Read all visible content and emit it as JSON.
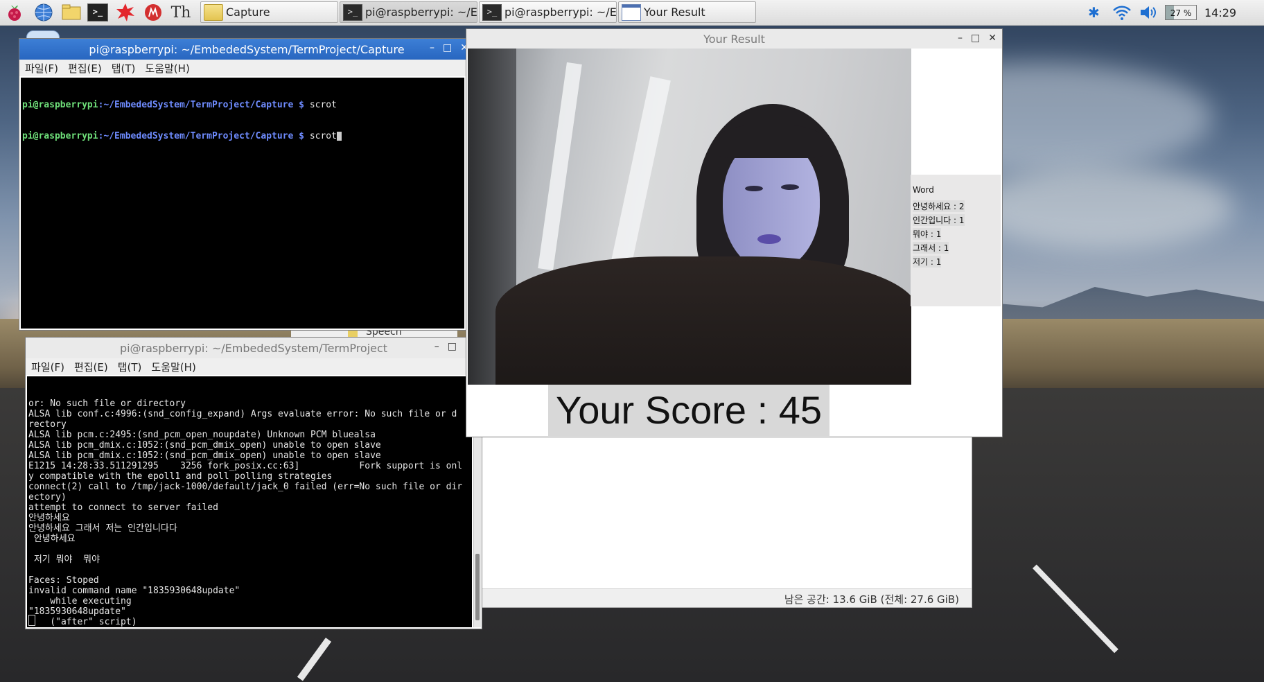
{
  "taskbar": {
    "tasks": [
      {
        "label": "Capture",
        "icon": "folder-icon"
      },
      {
        "label": "pi@raspberrypi: ~/E...",
        "icon": "terminal-icon"
      },
      {
        "label": "pi@raspberrypi: ~/E...",
        "icon": "terminal-icon"
      },
      {
        "label": "Your Result",
        "icon": "window-icon"
      }
    ],
    "battery": "27 %",
    "clock": "14:29"
  },
  "term1": {
    "title": "pi@raspberrypi: ~/EmbededSystem/TermProject/Capture",
    "menu": [
      "파일(F)",
      "편집(E)",
      "탭(T)",
      "도움말(H)"
    ],
    "lines": [
      {
        "user": "pi@raspberrypi",
        "path": ":~/EmbededSystem/TermProject/Capture $",
        "cmd": " scrot"
      },
      {
        "user": "pi@raspberrypi",
        "path": ":~/EmbededSystem/TermProject/Capture $",
        "cmd": " scrot"
      }
    ]
  },
  "term2": {
    "title": "pi@raspberrypi: ~/EmbededSystem/TermProject",
    "menu": [
      "파일(F)",
      "편집(E)",
      "탭(T)",
      "도움말(H)"
    ],
    "output": "or: No such file or directory\nALSA lib conf.c:4996:(snd_config_expand) Args evaluate error: No such file or d\nrectory\nALSA lib pcm.c:2495:(snd_pcm_open_noupdate) Unknown PCM bluealsa\nALSA lib pcm_dmix.c:1052:(snd_pcm_dmix_open) unable to open slave\nALSA lib pcm_dmix.c:1052:(snd_pcm_dmix_open) unable to open slave\nE1215 14:28:33.511291295    3256 fork_posix.cc:63]           Fork support is onl\ny compatible with the epoll1 and poll polling strategies\nconnect(2) call to /tmp/jack-1000/default/jack_0 failed (err=No such file or dir\nectory)\nattempt to connect to server failed\n안녕하세요\n안녕하세요 그래서 저는 인간입니다다\n 안녕하세요\n\n 저기 뭐야  뭐야\n\nFaces: Stoped\ninvalid command name \"1835930648update\"\n    while executing\n\"1835930648update\"\n    (\"after\" script)"
  },
  "background_window": {
    "partial_label": "Speech",
    "status": "남은 공간: 13.6 GiB (전체: 27.6 GiB)"
  },
  "result": {
    "title": "Your Result",
    "word_header": "Word",
    "words": [
      "안녕하세요 : 2",
      "인간입니다 : 1",
      "뭐야 : 1",
      "그래서 : 1",
      "저기 : 1"
    ],
    "score": "Your Score : 45"
  },
  "colors": {
    "titlebar_active": "#2866c0",
    "prompt_user": "#6fe07a",
    "prompt_path": "#6f8cff"
  }
}
